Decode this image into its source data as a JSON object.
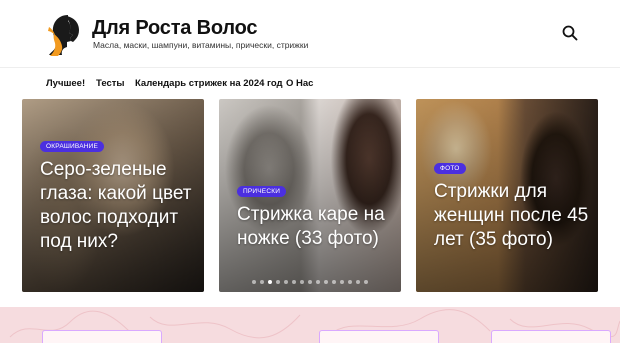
{
  "header": {
    "title": "Для Роста Волос",
    "description": "Масла, маски, шампуни, витамины, прически, стрижки",
    "logo_icon": "woman-profile-logo",
    "search_icon": "search-icon"
  },
  "nav": {
    "items": [
      {
        "label": "Лучшее!"
      },
      {
        "label": "Тесты"
      },
      {
        "label": "Календарь стрижек на 2024 год"
      },
      {
        "label": "О Нас"
      }
    ]
  },
  "cards": [
    {
      "category": "Окрашивание",
      "title": "Серо-зеленые глаза: какой цвет волос подходит под них?"
    },
    {
      "category": "Прически",
      "title": "Стрижка каре на ножке (33 фото)"
    },
    {
      "category": "Фото",
      "title": "Стрижки для женщин после 45 лет (35 фото)"
    }
  ],
  "slider": {
    "dot_count": 15,
    "active_dot": 2
  },
  "colors": {
    "accent": "#4b2fe0",
    "logo_orange": "#f29a1f",
    "logo_dark": "#1a1a1a",
    "bottom_band": "#f6dcdf"
  }
}
